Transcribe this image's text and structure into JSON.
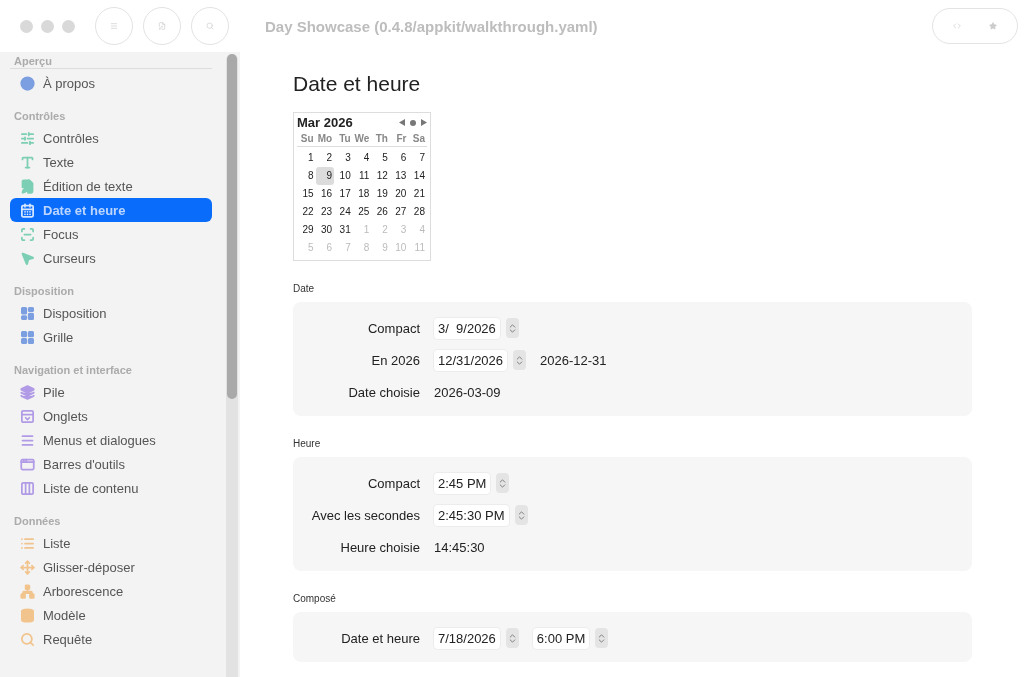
{
  "window": {
    "title": "Day Showcase (0.4.8/appkit/walkthrough.yaml)"
  },
  "sidebar": {
    "sections": [
      {
        "title": "Aperçu",
        "items": [
          {
            "label": "À propos",
            "selected": false,
            "color": "#7b9fe0"
          }
        ]
      },
      {
        "title": "Contrôles",
        "items": [
          {
            "label": "Contrôles",
            "selected": false,
            "color": "#7ccfb4"
          },
          {
            "label": "Texte",
            "selected": false,
            "color": "#7ccfb4"
          },
          {
            "label": "Édition de texte",
            "selected": false,
            "color": "#7ccfb4"
          },
          {
            "label": "Date et heure",
            "selected": true
          },
          {
            "label": "Focus",
            "selected": false,
            "color": "#7ccfb4"
          },
          {
            "label": "Curseurs",
            "selected": false,
            "color": "#7ccfb4"
          }
        ]
      },
      {
        "title": "Disposition",
        "items": [
          {
            "label": "Disposition",
            "selected": false,
            "color": "#7b9fe0"
          },
          {
            "label": "Grille",
            "selected": false,
            "color": "#7b9fe0"
          }
        ]
      },
      {
        "title": "Navigation et interface",
        "items": [
          {
            "label": "Pile",
            "selected": false,
            "color": "#b19be6"
          },
          {
            "label": "Onglets",
            "selected": false,
            "color": "#b19be6"
          },
          {
            "label": "Menus et dialogues",
            "selected": false,
            "color": "#b19be6"
          },
          {
            "label": "Barres d'outils",
            "selected": false,
            "color": "#b19be6"
          },
          {
            "label": "Liste de contenu",
            "selected": false,
            "color": "#b19be6"
          }
        ]
      },
      {
        "title": "Données",
        "items": [
          {
            "label": "Liste",
            "selected": false,
            "color": "#f2c48d"
          },
          {
            "label": "Glisser-déposer",
            "selected": false,
            "color": "#f2c48d"
          },
          {
            "label": "Arborescence",
            "selected": false,
            "color": "#f2c48d"
          },
          {
            "label": "Modèle",
            "selected": false,
            "color": "#f2c48d"
          },
          {
            "label": "Requête",
            "selected": false,
            "color": "#f2c48d"
          }
        ]
      }
    ]
  },
  "page": {
    "title": "Date et heure",
    "calendar": {
      "month": "Mar 2026",
      "weekdays": [
        "Su",
        "Mo",
        "Tu",
        "We",
        "Th",
        "Fr",
        "Sa"
      ],
      "weeks": [
        [
          {
            "label": "1",
            "outside": false,
            "selected": false
          },
          {
            "label": "2",
            "outside": false,
            "selected": false
          },
          {
            "label": "3",
            "outside": false,
            "selected": false
          },
          {
            "label": "4",
            "outside": false,
            "selected": false
          },
          {
            "label": "5",
            "outside": false,
            "selected": false
          },
          {
            "label": "6",
            "outside": false,
            "selected": false
          },
          {
            "label": "7",
            "outside": false,
            "selected": false
          }
        ],
        [
          {
            "label": "8",
            "outside": false,
            "selected": false
          },
          {
            "label": "9",
            "outside": false,
            "selected": true
          },
          {
            "label": "10",
            "outside": false,
            "selected": false
          },
          {
            "label": "11",
            "outside": false,
            "selected": false
          },
          {
            "label": "12",
            "outside": false,
            "selected": false
          },
          {
            "label": "13",
            "outside": false,
            "selected": false
          },
          {
            "label": "14",
            "outside": false,
            "selected": false
          }
        ],
        [
          {
            "label": "15",
            "outside": false,
            "selected": false
          },
          {
            "label": "16",
            "outside": false,
            "selected": false
          },
          {
            "label": "17",
            "outside": false,
            "selected": false
          },
          {
            "label": "18",
            "outside": false,
            "selected": false
          },
          {
            "label": "19",
            "outside": false,
            "selected": false
          },
          {
            "label": "20",
            "outside": false,
            "selected": false
          },
          {
            "label": "21",
            "outside": false,
            "selected": false
          }
        ],
        [
          {
            "label": "22",
            "outside": false,
            "selected": false
          },
          {
            "label": "23",
            "outside": false,
            "selected": false
          },
          {
            "label": "24",
            "outside": false,
            "selected": false
          },
          {
            "label": "25",
            "outside": false,
            "selected": false
          },
          {
            "label": "26",
            "outside": false,
            "selected": false
          },
          {
            "label": "27",
            "outside": false,
            "selected": false
          },
          {
            "label": "28",
            "outside": false,
            "selected": false
          }
        ],
        [
          {
            "label": "29",
            "outside": false,
            "selected": false
          },
          {
            "label": "30",
            "outside": false,
            "selected": false
          },
          {
            "label": "31",
            "outside": false,
            "selected": false
          },
          {
            "label": "1",
            "outside": true,
            "selected": false
          },
          {
            "label": "2",
            "outside": true,
            "selected": false
          },
          {
            "label": "3",
            "outside": true,
            "selected": false
          },
          {
            "label": "4",
            "outside": true,
            "selected": false
          }
        ],
        [
          {
            "label": "5",
            "outside": true,
            "selected": false
          },
          {
            "label": "6",
            "outside": true,
            "selected": false
          },
          {
            "label": "7",
            "outside": true,
            "selected": false
          },
          {
            "label": "8",
            "outside": true,
            "selected": false
          },
          {
            "label": "9",
            "outside": true,
            "selected": false
          },
          {
            "label": "10",
            "outside": true,
            "selected": false
          },
          {
            "label": "11",
            "outside": true,
            "selected": false
          }
        ]
      ]
    },
    "groups": [
      {
        "title": "Date",
        "rows": [
          {
            "kind": "picker",
            "label": "Compact",
            "value": "3/  9/2026"
          },
          {
            "kind": "picker",
            "label": "En 2026",
            "value": "12/31/2026",
            "extra": "2026-12-31"
          },
          {
            "kind": "text",
            "label": "Date choisie",
            "value": "2026-03-09"
          }
        ]
      },
      {
        "title": "Heure",
        "rows": [
          {
            "kind": "picker",
            "label": "Compact",
            "value": "2:45 PM"
          },
          {
            "kind": "picker",
            "label": "Avec les secondes",
            "value": "2:45:30 PM"
          },
          {
            "kind": "text",
            "label": "Heure choisie",
            "value": "14:45:30"
          }
        ]
      },
      {
        "title": "Composé",
        "rows": [
          {
            "kind": "pair",
            "label": "Date et heure",
            "value": "7/18/2026",
            "value2": "6:00 PM"
          }
        ]
      }
    ]
  }
}
